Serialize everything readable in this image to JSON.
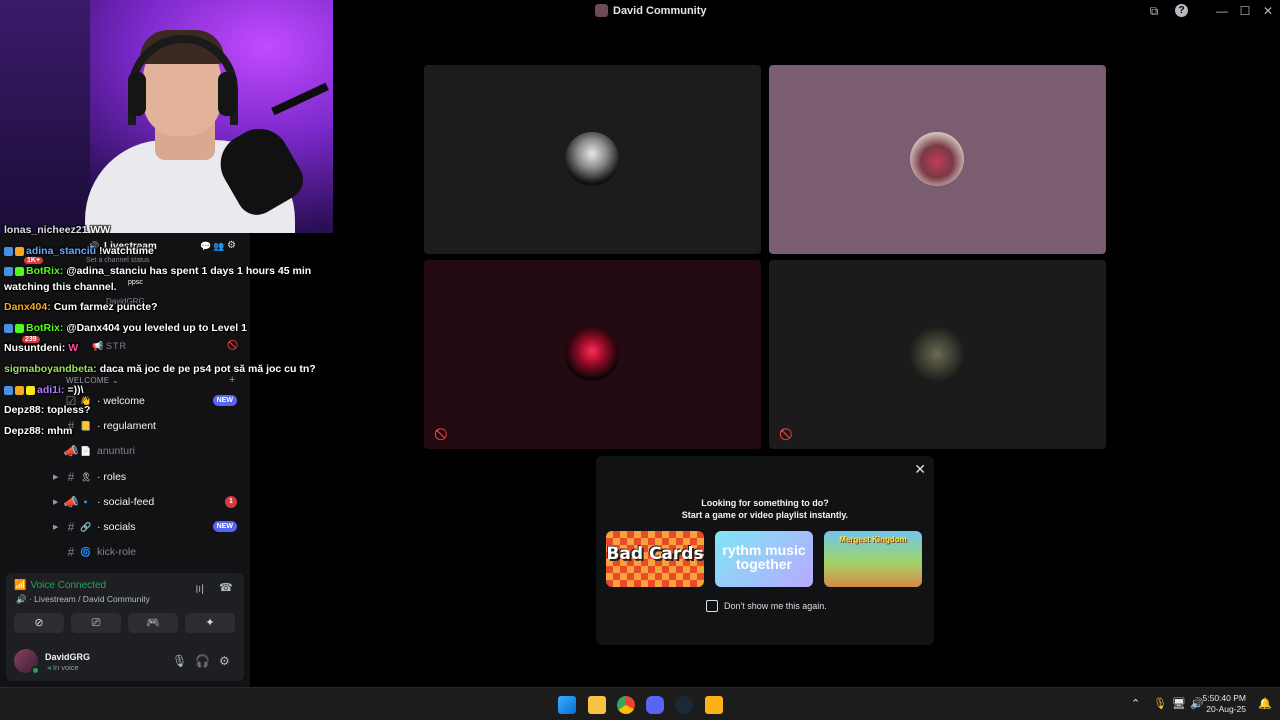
{
  "window": {
    "title": "David Community",
    "minimize": "—",
    "maximize": "☐",
    "close": "✕"
  },
  "server": {
    "voice_channel_header": "Livestream",
    "status_placeholder": "Set a channel status",
    "voice_users": [
      "DavidGRG",
      "ppsc"
    ],
    "str_label": "STR",
    "category": "WELCOME"
  },
  "channels": [
    {
      "name": "welcome",
      "emoji": "👋",
      "badge": "NEW",
      "arrow": false,
      "muted": false
    },
    {
      "name": "regulament",
      "emoji": "📒",
      "badge": "",
      "arrow": false,
      "muted": false
    },
    {
      "name": "anunturi",
      "emoji": "📄",
      "badge": "",
      "arrow": false,
      "muted": true
    },
    {
      "name": "roles",
      "emoji": "🎗",
      "badge": "",
      "arrow": true,
      "muted": false
    },
    {
      "name": "social-feed",
      "emoji": "🔹",
      "badge": "1",
      "arrow": true,
      "muted": false
    },
    {
      "name": "socials",
      "emoji": "🔗",
      "badge": "NEW",
      "arrow": true,
      "muted": false
    },
    {
      "name": "kick-role",
      "emoji": "🌀",
      "badge": "",
      "arrow": false,
      "muted": true
    }
  ],
  "voice": {
    "status": "Voice Connected",
    "location": "Livestream / David Community"
  },
  "user": {
    "name": "DavidGRG",
    "status": "In voice"
  },
  "chat": [
    {
      "user": "adina_stanciu",
      "text": "!watchtime",
      "color": "#6aa7ff"
    },
    {
      "user": "BotRix:",
      "text": "@adina_stanciu has spent 1 days 1 hours 45 min",
      "color": "#53fc18"
    },
    {
      "user": "",
      "text": "watching this channel.",
      "color": "#ffffff"
    },
    {
      "user": "Danx404:",
      "text": "Cum farmez puncte?",
      "color": "#f5a623"
    },
    {
      "user": "BotRix:",
      "text": "@Danx404 you leveled up to Level 1",
      "color": "#53fc18"
    },
    {
      "user": "Nusuntdeni:",
      "text": "W",
      "color": "#ffffff"
    },
    {
      "user": "sigmaboyandbeta:",
      "text": "daca mă joc de pe ps4 pot să mă joc cu tn?",
      "color": "#9be15d"
    },
    {
      "user": "adi1i:",
      "text": "=))\\",
      "color": "#b07cff"
    },
    {
      "user": "Depz88:",
      "text": "topless?",
      "color": "#ffffff"
    },
    {
      "user": "Depz88:",
      "text": "mhm",
      "color": "#ffffff"
    }
  ],
  "chat_badges": [
    "1K+",
    "239"
  ],
  "popup": {
    "line1": "Looking for something to do?",
    "line2": "Start a game or video playlist instantly.",
    "checkbox_label": "Don't show me this again.",
    "cards": [
      "Bad Cards",
      "rythm music together",
      "Mergest Kingdom"
    ]
  },
  "clock": {
    "time": "5:50:40 PM",
    "date": "20-Aug-25"
  },
  "colors": {
    "accent": "#5865f2",
    "online": "#23a55a",
    "danger": "#da373c"
  }
}
